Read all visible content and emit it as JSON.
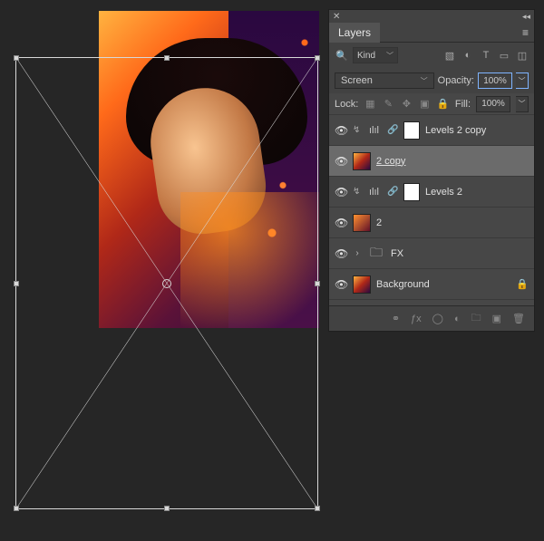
{
  "panel": {
    "title": "Layers",
    "filter_label": "Kind",
    "blend_mode": "Screen",
    "opacity_label": "Opacity:",
    "opacity_value": "100%",
    "fill_label": "Fill:",
    "fill_value": "100%",
    "lock_label": "Lock:"
  },
  "layers": [
    {
      "name": "Levels 2 copy",
      "type": "adjustment",
      "visible": true
    },
    {
      "name": "2 copy",
      "type": "image",
      "visible": true,
      "selected": true
    },
    {
      "name": "Levels 2",
      "type": "adjustment",
      "visible": true
    },
    {
      "name": "2",
      "type": "image",
      "visible": true
    },
    {
      "name": "FX",
      "type": "group",
      "visible": true
    },
    {
      "name": "Background",
      "type": "locked",
      "visible": true
    }
  ],
  "footer_icons": [
    "link",
    "fx",
    "mask",
    "adjust",
    "group",
    "new",
    "delete"
  ]
}
